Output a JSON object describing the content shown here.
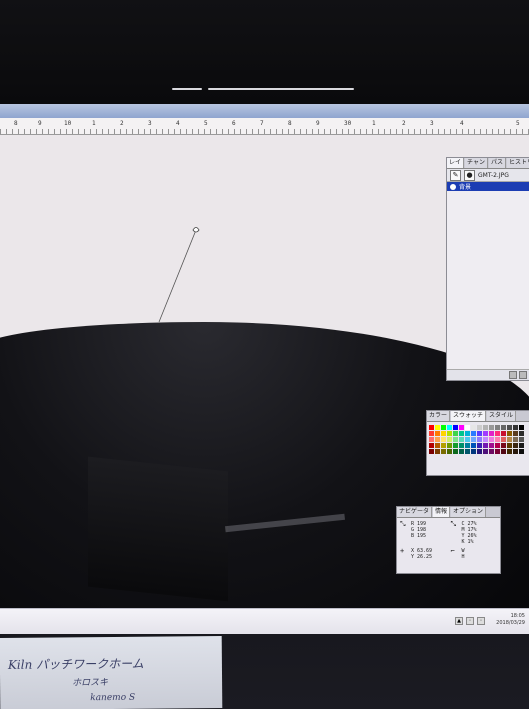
{
  "window": {
    "ruler_labels": [
      "8",
      "9",
      "10",
      "1",
      "2",
      "3",
      "4",
      "5",
      "6",
      "7",
      "8",
      "9",
      "30",
      "1",
      "2",
      "3",
      "4",
      "5"
    ]
  },
  "layers_panel": {
    "tabs": [
      "レイ",
      "チャン",
      "パス",
      "ヒストリー"
    ],
    "document_name": "GMT-2.JPG",
    "layer_name": "背景"
  },
  "color_panel": {
    "tabs": [
      "カラー",
      "スウォッチ",
      "スタイル"
    ],
    "swatch_colors": [
      "#ff0000",
      "#ffff00",
      "#00ff00",
      "#00ffff",
      "#0000ff",
      "#ff00ff",
      "#ffffff",
      "#e6e6e6",
      "#cccccc",
      "#b3b3b3",
      "#999999",
      "#808080",
      "#666666",
      "#4d4d4d",
      "#333333",
      "#000000",
      "#ff3b30",
      "#ff7a00",
      "#ffd400",
      "#b2e000",
      "#3fd44a",
      "#00c48c",
      "#00b3d6",
      "#2a7bff",
      "#5a3dff",
      "#a03cff",
      "#e024c8",
      "#ff2d7a",
      "#c8102e",
      "#8a5a00",
      "#5b3b1f",
      "#2b2b2b",
      "#ff6d6d",
      "#ffa24d",
      "#ffe36b",
      "#d3ef6a",
      "#7ee38a",
      "#5ad9b8",
      "#4cc9ef",
      "#6ea8ff",
      "#8f7bff",
      "#c38bff",
      "#f07ae0",
      "#ff7fb0",
      "#e06060",
      "#b58a4d",
      "#7d6b55",
      "#555555",
      "#b30000",
      "#b35900",
      "#b3a000",
      "#6d9a00",
      "#149b2c",
      "#008f6b",
      "#007f9e",
      "#0052b8",
      "#3a1fb3",
      "#7319b3",
      "#a00f8f",
      "#b3004d",
      "#7a0a1c",
      "#5c3a00",
      "#3b2612",
      "#1a1a1a",
      "#7a0000",
      "#7a3c00",
      "#7a6c00",
      "#4a6900",
      "#0e6a1e",
      "#006149",
      "#00566b",
      "#00377d",
      "#27157a",
      "#4e117a",
      "#6d0a61",
      "#7a0034",
      "#520713",
      "#3e2700",
      "#28190c",
      "#0d0d0d"
    ]
  },
  "info_panel": {
    "tabs": [
      "ナビゲータ",
      "情報",
      "オプション"
    ],
    "rgb": {
      "r_label": "R",
      "g_label": "G",
      "b_label": "B",
      "r": "199",
      "g": "198",
      "b": "195"
    },
    "cmyk": {
      "c_label": "C",
      "m_label": "M",
      "y_label": "Y",
      "k_label": "K",
      "c": "27%",
      "m": "17%",
      "y": "26%",
      "k": "1%"
    },
    "xy": {
      "x_label": "X",
      "y_label": "Y",
      "x": "63.69",
      "y": "26.25"
    },
    "wh": {
      "w_label": "W",
      "h_label": "H",
      "w": "",
      "h": ""
    }
  },
  "taskbar": {
    "time": "18:05",
    "date": "2018/03/29"
  },
  "note": {
    "line1": "Kiln パッチワークホーム",
    "line2": "ホロスキ",
    "line3": "kanemo S"
  }
}
